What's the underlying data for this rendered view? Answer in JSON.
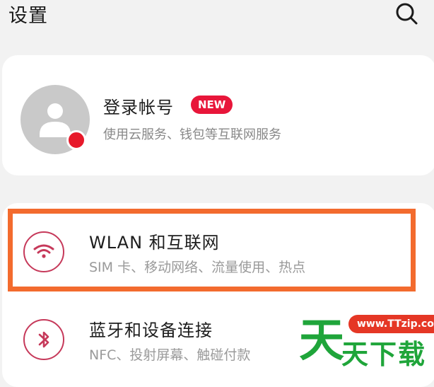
{
  "header": {
    "title": "设置",
    "search_icon": "search-icon"
  },
  "account": {
    "title": "登录帐号",
    "badge": "NEW",
    "subtitle": "使用云服务、钱包等互联网服务",
    "avatar_icon": "person-icon",
    "dot_color": "#e7192a"
  },
  "settings": [
    {
      "title": "WLAN 和互联网",
      "subtitle": "SIM 卡、移动网络、流量使用、热点",
      "icon": "wifi-icon"
    },
    {
      "title": "蓝牙和设备连接",
      "subtitle": "NFC、投射屏幕、触碰付款",
      "icon": "bluetooth-icon"
    }
  ],
  "highlight": {
    "color": "#f36b2e"
  },
  "watermark": {
    "big": "天",
    "pill": "www.TTzip.com",
    "small": "天下载"
  },
  "colors": {
    "accent": "#c6395a",
    "badge": "#e8163a",
    "watermark_green": "#1fa53a"
  }
}
